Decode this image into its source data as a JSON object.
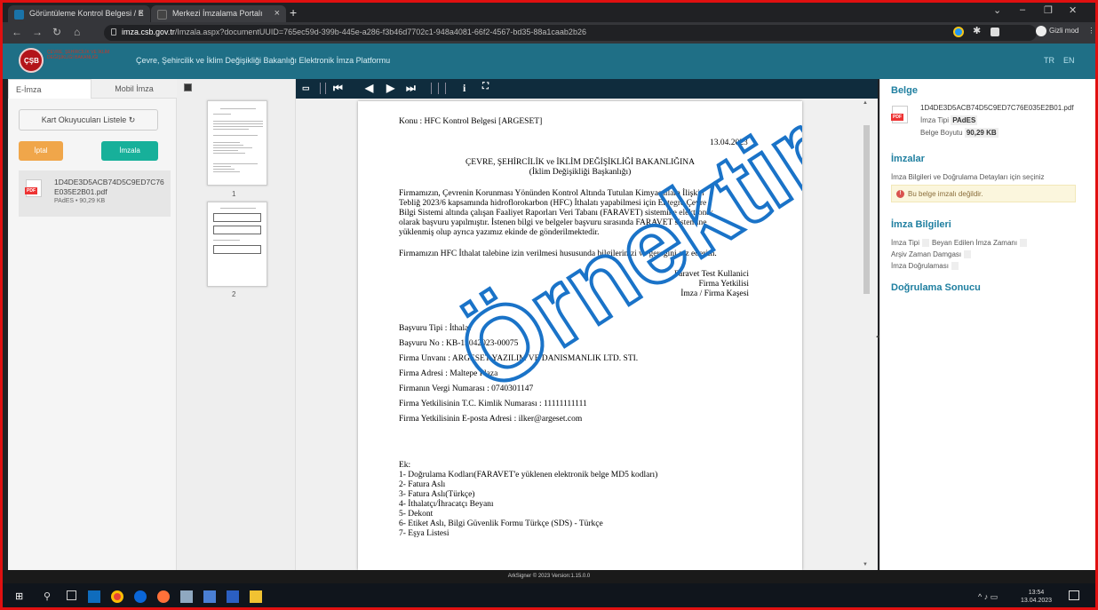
{
  "browser": {
    "tabs": [
      {
        "title": "Görüntüleme Kontrol Belgesi / E"
      },
      {
        "title": "Merkezi İmzalama Portalı"
      }
    ],
    "url_domain": "imza.csb.gov.tr",
    "url_path": "/Imzala.aspx?documentUUID=765ec59d-399b-445e-a286-f3b46d7702c1-948a4081-66f2-4567-bd35-88a1caab2b26",
    "profile_label": "Gizli mod"
  },
  "header": {
    "logo_text": "ÇEVRE, ŞEHİRCİLİK VE İKLİM DEĞİŞİKLİĞİ BAKANLIĞI",
    "platform_title": "Çevre, Şehircilik ve İklim Değişikliği Bakanlığı Elektronik İmza Platformu",
    "lang_tr": "TR",
    "lang_en": "EN"
  },
  "left": {
    "tab_eimza": "E-İmza",
    "tab_mobil": "Mobil İmza",
    "card_reader_button": "Kart Okuyucuları Listele ↻",
    "cancel_button": "İptal",
    "sign_button": "İmzala",
    "file": {
      "name": "1D4DE3D5ACB74D5C9ED7C76E035E2B01.pdf",
      "meta": "PAdES • 90,29 KB"
    }
  },
  "thumbs": {
    "page1": "1",
    "page2": "2"
  },
  "document": {
    "konu": "Konu : HFC Kontrol Belgesi [ARGESET]",
    "date": "13.04.2023",
    "ministry": "ÇEVRE, ŞEHİRCİLİK ve İKLİM  DEĞİŞİKLİĞİ BAKANLIĞINA",
    "department": "(İklim Değişikliği Başkanlığı)",
    "para1": [
      "Firmamızın, Çevrenin Korunması Yönünden Kontrol Altında Tutulan Kimyasallara İlişkin",
      "Tebliğ 2023/6 kapsamında hidroflorokarbon (HFC) İthalatı yapabilmesi için Entegre Çevre",
      "Bilgi Sistemi altında çalışan Faaliyet Raporları Veri Tabanı (FARAVET) sistemine elektronik",
      "olarak başvuru yapılmıştır. İstenen bilgi ve belgeler başvuru sırasında FARAVET sistemine",
      "yüklenmiş olup ayrıca yazımız ekinde de gönderilmektedir."
    ],
    "para2": "Firmamızın HFC İthalat talebine izin verilmesi hususunda bilgilerinizi ve gereğini arz ederim.",
    "signature": [
      "Faravet  Test Kullanici",
      "Firma Yetkilisi",
      "İmza / Firma Kaşesi"
    ],
    "details": [
      "Başvuru Tipi : İthalat",
      "Başvuru No : KB-13042023-00075",
      "Firma Unvanı : ARGESET YAZILIM VE DANISMANLIK LTD. STI.",
      "Firma Adresi : Maltepe Plaza",
      "Firmanın Vergi Numarası : 0740301147",
      "Firma Yetkilisinin T.C. Kimlik Numarası : 11111111111",
      "Firma Yetkilisinin E-posta Adresi : ilker@argeset.com"
    ],
    "attachments": [
      "Ek:",
      "1- Doğrulama Kodları(FARAVET'e yüklenen elektronik belge MD5 kodları)",
      "2- Fatura Aslı",
      "3- Fatura Aslı(Türkçe)",
      "4- İthalatçı/İhracatçı Beyanı",
      "5- Dekont",
      "6- Etiket Aslı, Bilgi Güvenlik Formu Türkçe (SDS) - Türkçe",
      "7- Eşya Listesi"
    ],
    "watermark": "Örnektir"
  },
  "right": {
    "belge_title": "Belge",
    "file_name": "1D4DE3D5ACB74D5C9ED7C76E035E2B01.pdf",
    "sig_type_label": "İmza Tipi",
    "sig_type_value": "PAdES",
    "size_label": "Belge Boyutu",
    "size_value": "90,29 KB",
    "imzalar_title": "İmzalar",
    "imzalar_sub": "İmza Bilgileri ve Doğrulama Detayları için seçiniz",
    "alert": "Bu belge imzalı değildir.",
    "info_title": "İmza Bilgileri",
    "info_row1_a": "İmza Tipi",
    "info_row1_b": "Beyan Edilen İmza Zamanı",
    "info_row2": "Arşiv Zaman Damgası",
    "info_row3": "İmza Doğrulaması",
    "verify_title": "Doğrulama Sonucu"
  },
  "footer": {
    "text": "ArkSigner © 2023 Version:1.15.0.0"
  },
  "taskbar": {
    "time": "13:54",
    "date": "13.04.2023"
  },
  "colors": {
    "header": "#1f6f86",
    "accent": "#1f7fa0",
    "cancel": "#f0a64a",
    "sign": "#17b09a",
    "frame": "#e01010"
  }
}
